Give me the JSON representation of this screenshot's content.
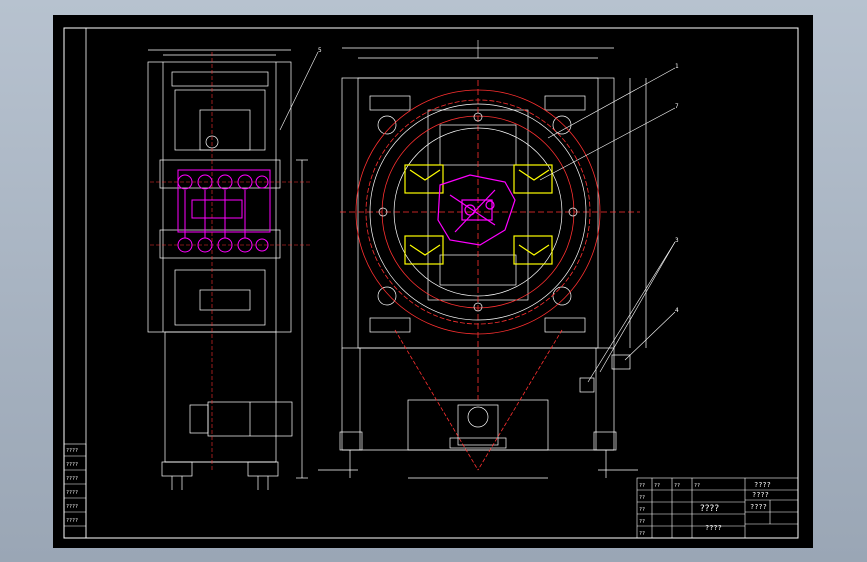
{
  "colors": {
    "background_frame": "#a9b4c2",
    "sheet": "#000000",
    "border": "#ffffff",
    "part_outline": "#ffffff",
    "center_line": "#ff3030",
    "magenta_parts": "#ff00ff",
    "yellow_parts": "#ffff00",
    "leader_lines": "#ffffff"
  },
  "balloons": [
    "1",
    "7",
    "3",
    "4",
    "5"
  ],
  "title_block": {
    "title_top": "????",
    "title_mid": "????",
    "title_bottom": "????",
    "code": "????",
    "scale_label": "????",
    "left_column": [
      "????",
      "????",
      "????",
      "????",
      "????",
      "????"
    ],
    "grid_labels": [
      "??",
      "??",
      "??",
      "??",
      "??",
      "??",
      "??",
      "??"
    ]
  }
}
